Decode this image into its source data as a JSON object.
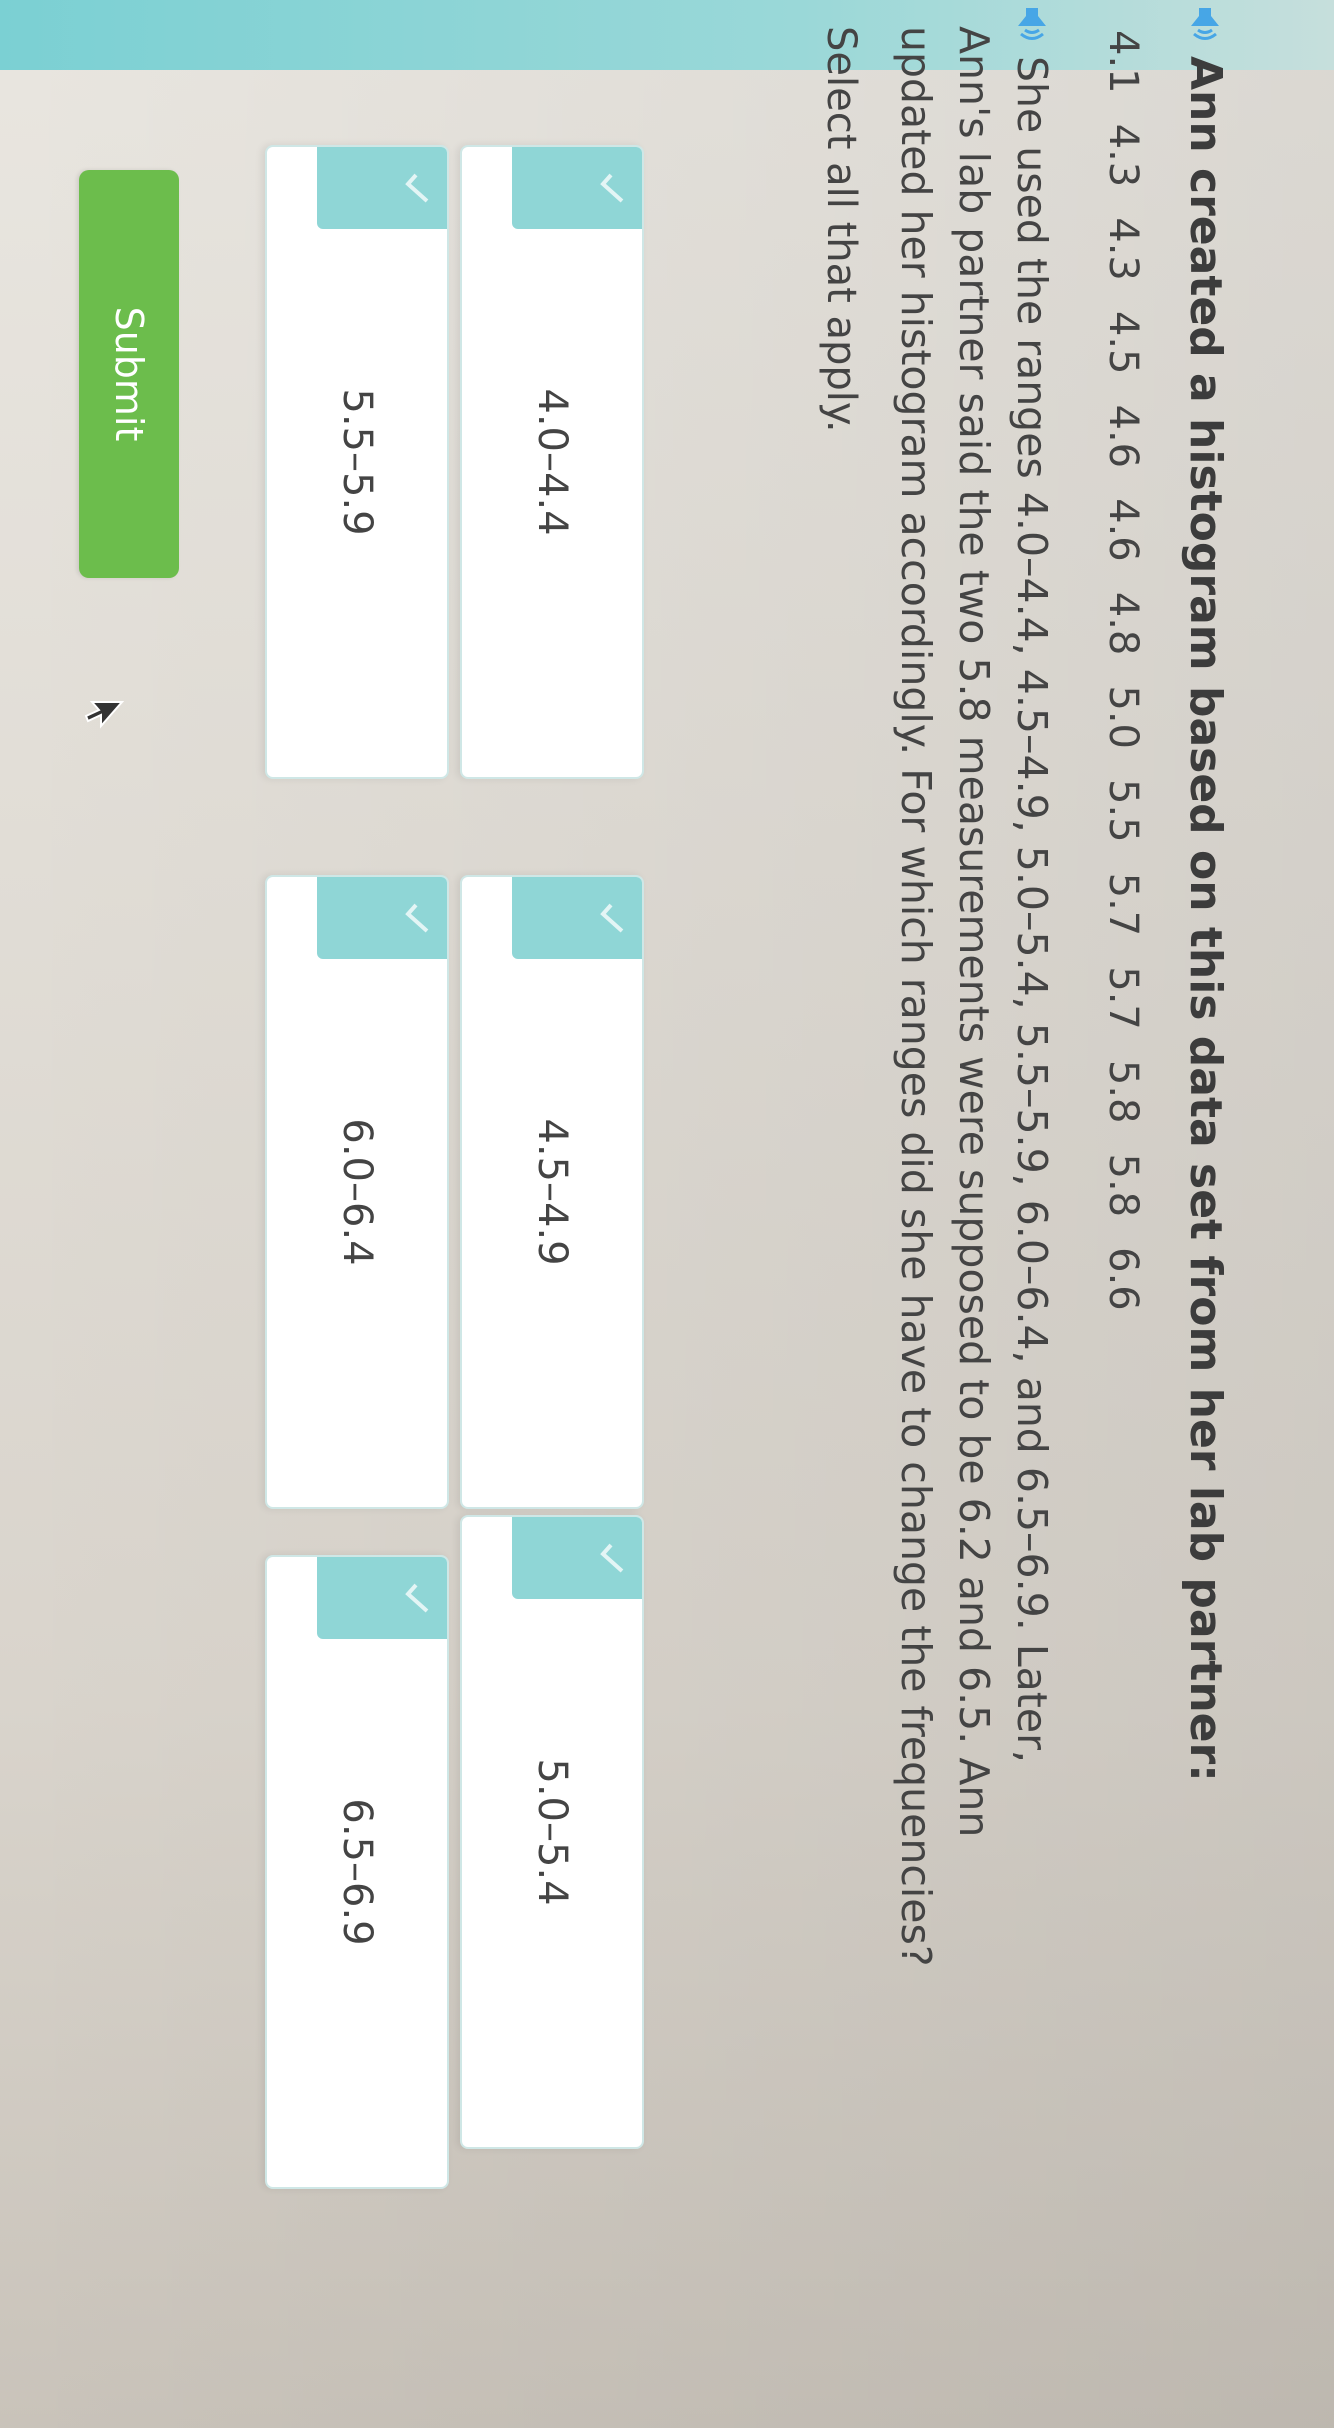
{
  "question": {
    "intro": "Ann created a histogram based on this data set from her lab partner:",
    "data_set": [
      "4.1",
      "4.3",
      "4.3",
      "4.5",
      "4.6",
      "4.6",
      "4.8",
      "5.0",
      "5.5",
      "5.7",
      "5.7",
      "5.8",
      "5.8",
      "6.6"
    ],
    "paragraph_lines": [
      "She used the ranges 4.0–4.4, 4.5–4.9, 5.0–5.4, 5.5–5.9, 6.0–6.4, and 6.5–6.9. Later,",
      "Ann's lab partner said the two 5.8 measurements were supposed to be 6.2 and 6.5. Ann",
      "updated her histogram accordingly. For which ranges did she have to change the frequencies?"
    ],
    "instruction": "Select all that apply."
  },
  "options": [
    {
      "label": "4.0–4.4"
    },
    {
      "label": "4.5–4.9"
    },
    {
      "label": "5.0–5.4"
    },
    {
      "label": "5.5–5.9"
    },
    {
      "label": "6.0–6.4"
    },
    {
      "label": "6.5–6.9"
    }
  ],
  "submit": {
    "label": "Submit"
  },
  "icons": {
    "audio": "speaker-icon",
    "option": "checkmark-icon",
    "pointer": "cursor-icon"
  },
  "colors": {
    "accent": "#8fd6d6",
    "submit": "#6cbd4c",
    "speaker": "#47a6e6"
  }
}
